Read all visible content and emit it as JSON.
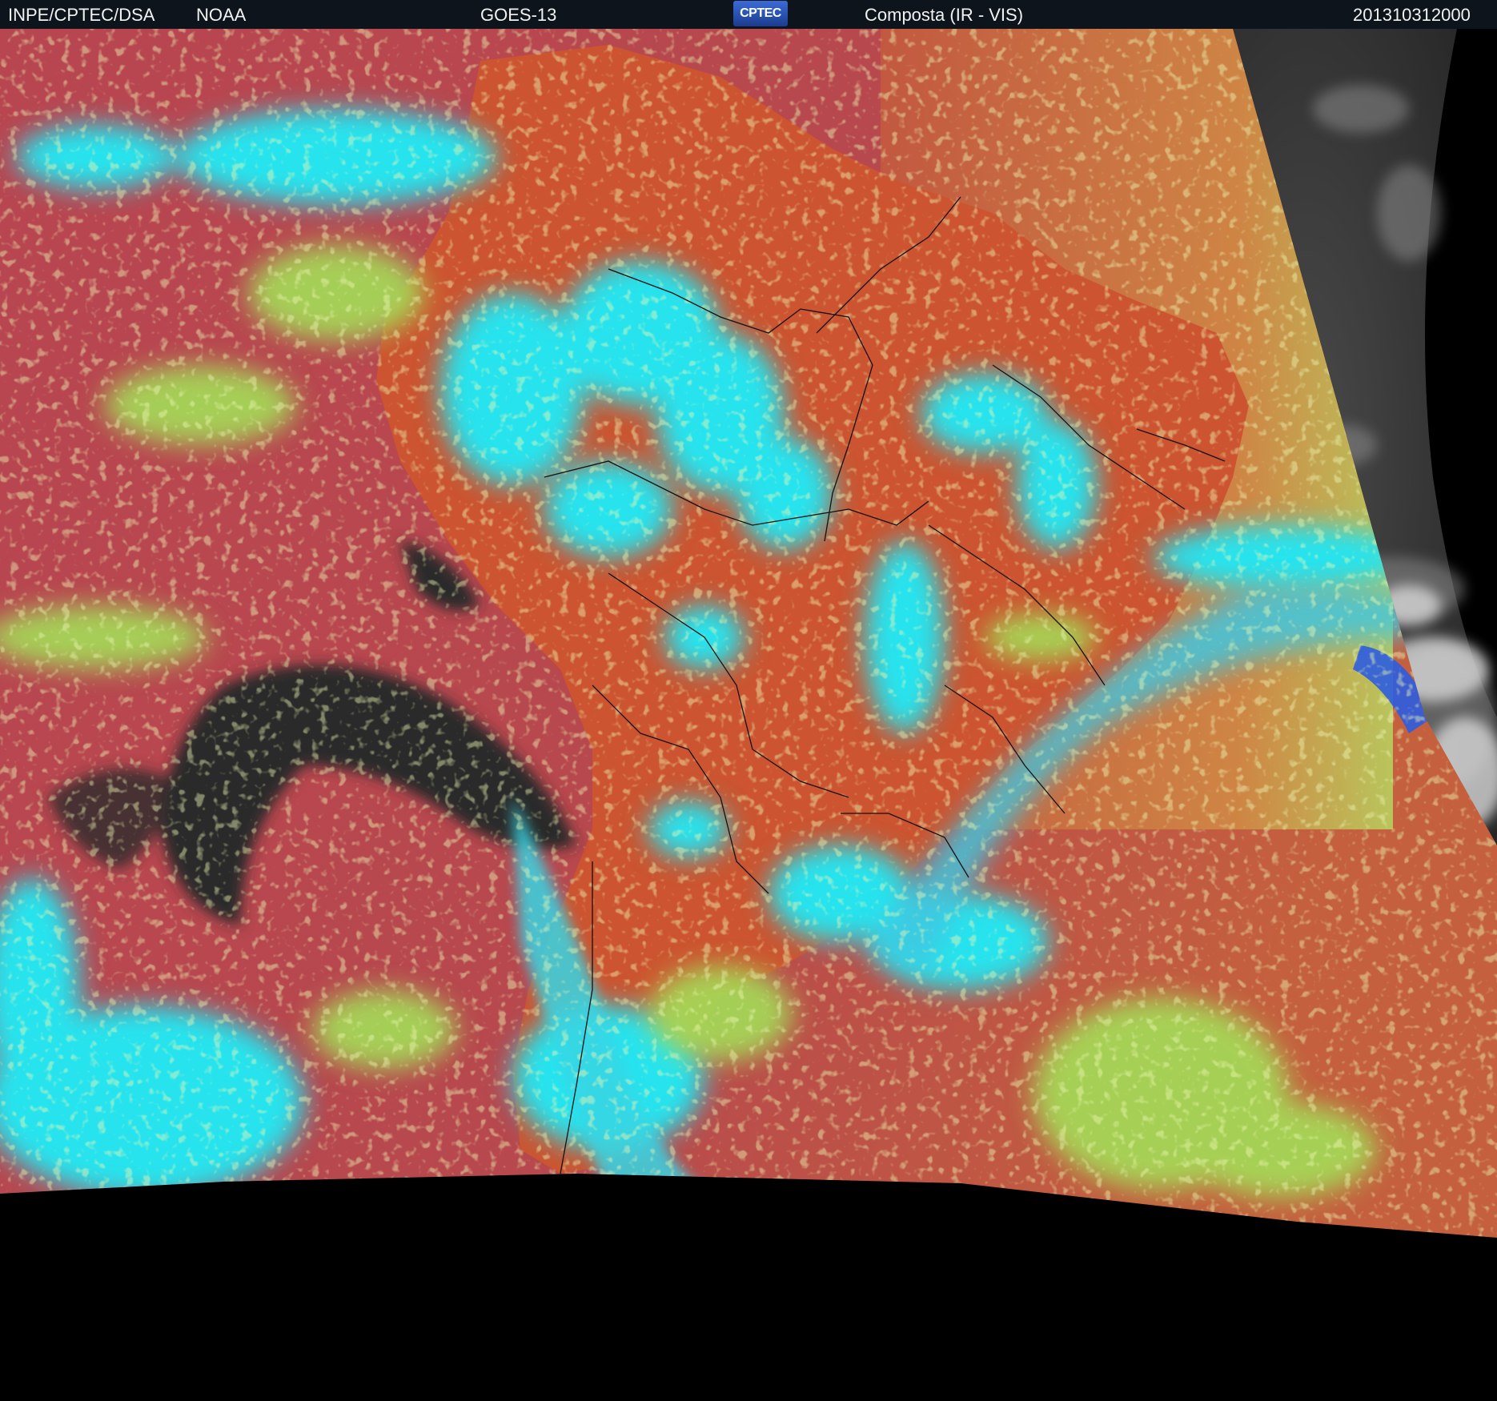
{
  "header": {
    "agency": "INPE/CPTEC/DSA",
    "source": "NOAA",
    "satellite": "GOES-13",
    "logo_text": "CPTEC",
    "product": "Composta (IR - VIS)",
    "timestamp": "201310312000"
  },
  "colors": {
    "header_bg": "#0d141c",
    "clear_ocean": "#b5484d",
    "land_warm": "#d4552c",
    "high_cloud": "#25e6ec",
    "mid_cloud": "#9ee05a",
    "cold_cloud": "#2f2f2f",
    "night_vis": "#3c3c3c",
    "no_data": "#000000"
  },
  "map_elements": {
    "continent": "south-america",
    "borders_color": "#111111"
  }
}
